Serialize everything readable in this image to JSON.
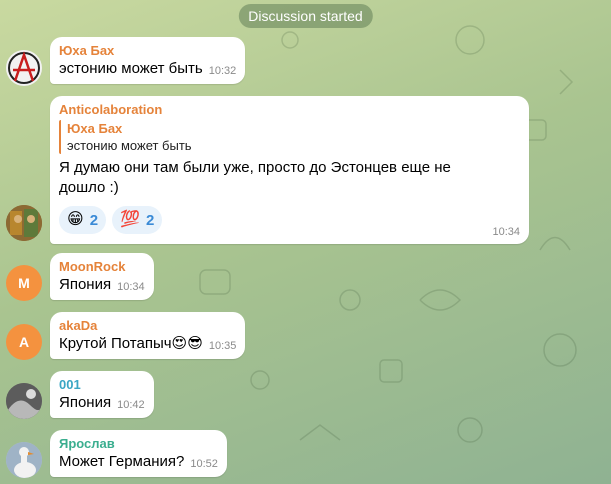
{
  "service_message": "Discussion started",
  "messages": [
    {
      "sender": "Юха Бах",
      "sender_color": "#e5833a",
      "text": "эстонию может быть",
      "time": "10:32",
      "avatar_icon": "anarchy-symbol-icon"
    },
    {
      "sender": "Anticolaboration",
      "sender_color": "#e5833a",
      "reply": {
        "name": "Юха Бах",
        "text": "эстонию может быть"
      },
      "text": "Я думаю они там были уже, просто до Эстонцев еще не дошло :)",
      "reactions": [
        {
          "emoji": "😁",
          "count": "2"
        },
        {
          "emoji": "💯",
          "count": "2"
        }
      ],
      "time": "10:34",
      "avatar_icon": "painting-avatar-icon"
    },
    {
      "sender": "MoonRock",
      "sender_color": "#e5833a",
      "text": "Япония",
      "time": "10:34",
      "avatar_letter": "M",
      "avatar_color": "#f4923f"
    },
    {
      "sender": "akaDa",
      "sender_color": "#e5833a",
      "text": "Крутой Потапыч😍😎",
      "time": "10:35",
      "avatar_letter": "A",
      "avatar_color": "#f4923f"
    },
    {
      "sender": "001",
      "sender_color": "#3aa6c4",
      "text": "Япония",
      "time": "10:42",
      "avatar_icon": "gray-photo-avatar-icon"
    },
    {
      "sender": "Ярослав",
      "sender_color": "#3aae8f",
      "text": "Может Германия?",
      "time": "10:52",
      "avatar_icon": "goose-avatar-icon"
    }
  ]
}
